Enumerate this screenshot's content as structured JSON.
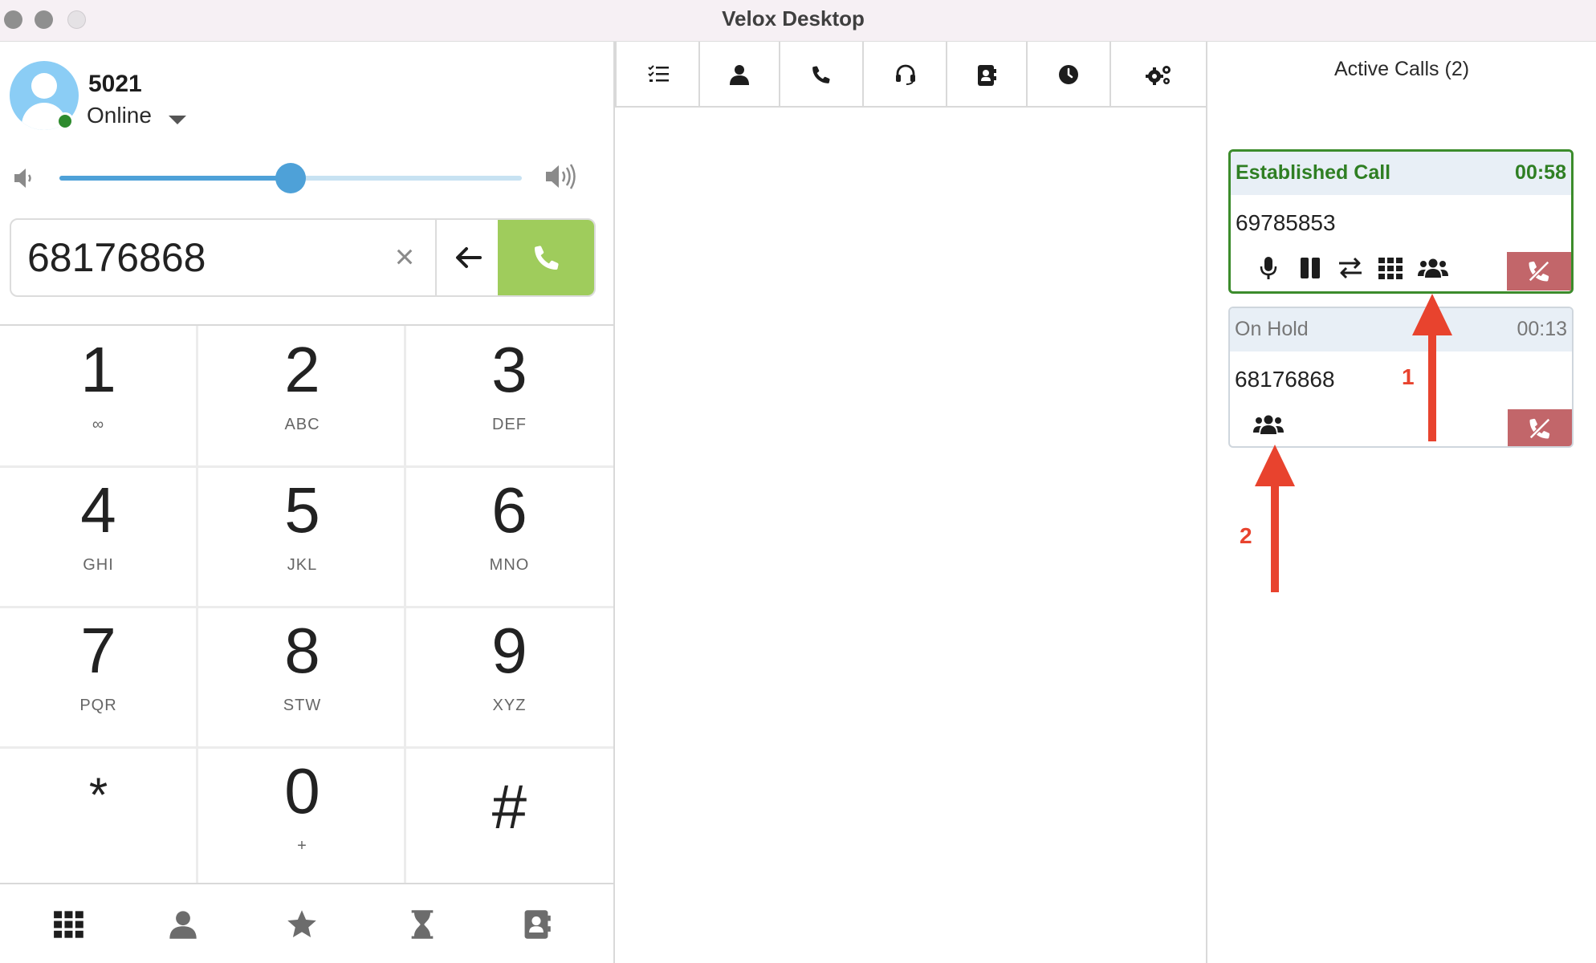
{
  "window": {
    "title": "Velox Desktop"
  },
  "profile": {
    "extension": "5021",
    "status": "Online"
  },
  "volume": {
    "level": 0.5
  },
  "dialer": {
    "number": "68176868"
  },
  "keypad": [
    {
      "digit": "1",
      "letters": "∞"
    },
    {
      "digit": "2",
      "letters": "ABC"
    },
    {
      "digit": "3",
      "letters": "DEF"
    },
    {
      "digit": "4",
      "letters": "GHI"
    },
    {
      "digit": "5",
      "letters": "JKL"
    },
    {
      "digit": "6",
      "letters": "MNO"
    },
    {
      "digit": "7",
      "letters": "PQR"
    },
    {
      "digit": "8",
      "letters": "STW"
    },
    {
      "digit": "9",
      "letters": "XYZ"
    },
    {
      "digit": "*",
      "letters": ""
    },
    {
      "digit": "0",
      "letters": "+"
    },
    {
      "digit": "#",
      "letters": ""
    }
  ],
  "bottom_nav": [
    "keypad-icon",
    "contact-icon",
    "star-icon",
    "hourglass-icon",
    "address-book-icon"
  ],
  "toolbar": [
    "checklist-icon",
    "user-icon",
    "phone-icon",
    "headset-icon",
    "address-book-icon",
    "clock-icon",
    "gears-icon"
  ],
  "active_calls": {
    "title": "Active Calls (2)",
    "calls": [
      {
        "state": "Established Call",
        "duration": "00:58",
        "number": "69785853",
        "actions": [
          "microphone-icon",
          "pause-icon",
          "transfer-icon",
          "dialpad-icon",
          "conference-icon"
        ]
      },
      {
        "state": "On Hold",
        "duration": "00:13",
        "number": "68176868",
        "actions": [
          "conference-icon"
        ]
      }
    ]
  },
  "annotations": {
    "arrow1": "1",
    "arrow2": "2"
  },
  "colors": {
    "established": "#2f7f23",
    "call_button": "#9fcc5c",
    "hangup": "#c2666a",
    "accent": "#4ea1d8",
    "annotation": "#e8432e"
  }
}
